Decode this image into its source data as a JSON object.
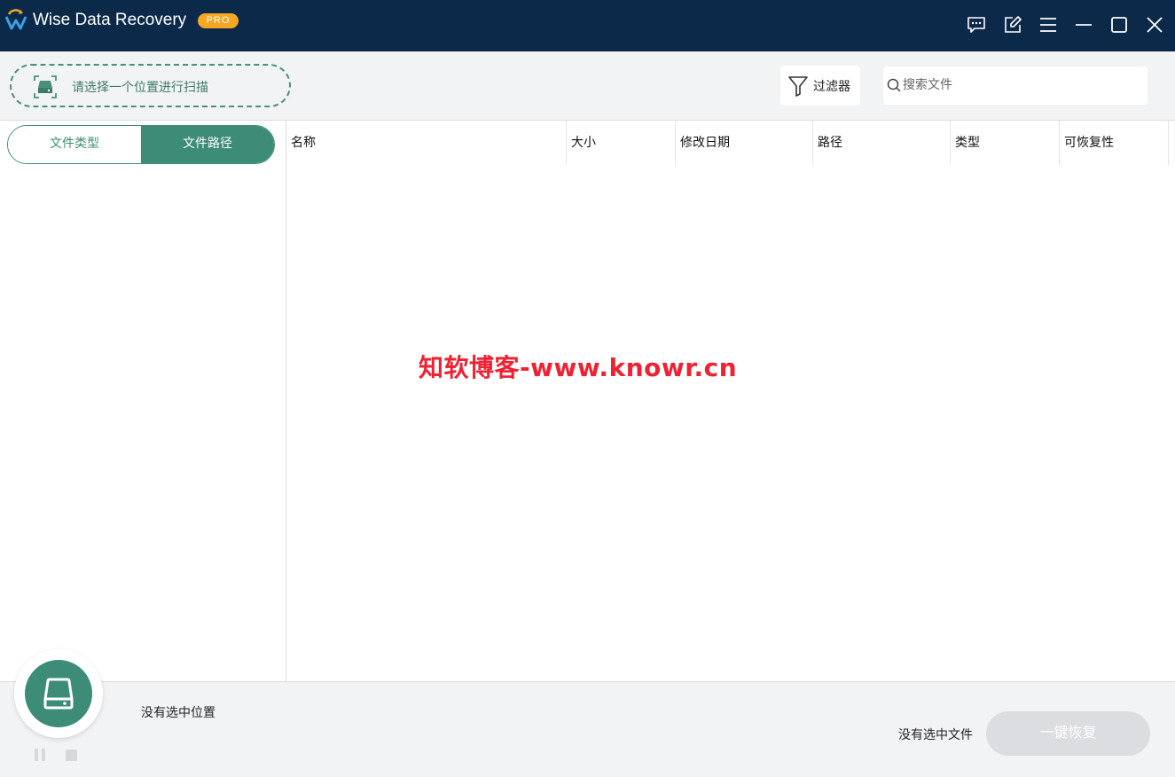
{
  "window": {
    "title": "Wise Data Recovery",
    "badge": "PRO"
  },
  "titlebar_icons": [
    "feedback-icon",
    "edit-icon",
    "menu-icon",
    "minimize-icon",
    "maximize-icon",
    "close-icon"
  ],
  "toolbar": {
    "scan_location_label": "请选择一个位置进行扫描",
    "filter_label": "过滤器",
    "search_placeholder": "搜索文件"
  },
  "sidebar": {
    "tabs": [
      {
        "label": "文件类型",
        "active": false
      },
      {
        "label": "文件路径",
        "active": true
      }
    ]
  },
  "table": {
    "columns": [
      "名称",
      "大小",
      "修改日期",
      "路径",
      "类型",
      "可恢复性"
    ],
    "rows": []
  },
  "watermark": "知软博客-www.knowr.cn",
  "bottom": {
    "location_status": "没有选中位置",
    "file_status": "没有选中文件",
    "recover_label": "一键恢复"
  },
  "colors": {
    "titlebar": "#0b2a4a",
    "accent": "#3d8c78",
    "badge": "#f5a623",
    "watermark": "#ee2233"
  }
}
